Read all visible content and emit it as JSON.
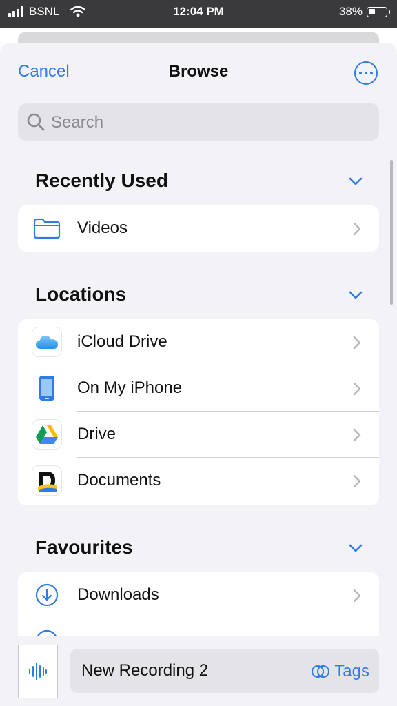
{
  "status_bar": {
    "carrier": "BSNL",
    "time": "12:04 PM",
    "battery": "38%"
  },
  "nav": {
    "cancel": "Cancel",
    "title": "Browse"
  },
  "search": {
    "placeholder": "Search"
  },
  "sections": {
    "recent": {
      "title": "Recently Used",
      "items": [
        {
          "label": "Videos",
          "icon": "folder-icon"
        }
      ]
    },
    "locations": {
      "title": "Locations",
      "items": [
        {
          "label": "iCloud Drive",
          "icon": "icloud-icon"
        },
        {
          "label": "On My iPhone",
          "icon": "iphone-icon"
        },
        {
          "label": "Drive",
          "icon": "google-drive-icon"
        },
        {
          "label": "Documents",
          "icon": "documents-app-icon"
        }
      ]
    },
    "favourites": {
      "title": "Favourites",
      "items": [
        {
          "label": "Downloads",
          "icon": "download-icon"
        }
      ]
    }
  },
  "bottom_bar": {
    "filename": "New Recording 2",
    "tags": "Tags"
  },
  "colors": {
    "accent": "#2f7ce6",
    "sheet_bg": "#f2f2f7",
    "status_bar_bg": "#3a3a3c"
  }
}
